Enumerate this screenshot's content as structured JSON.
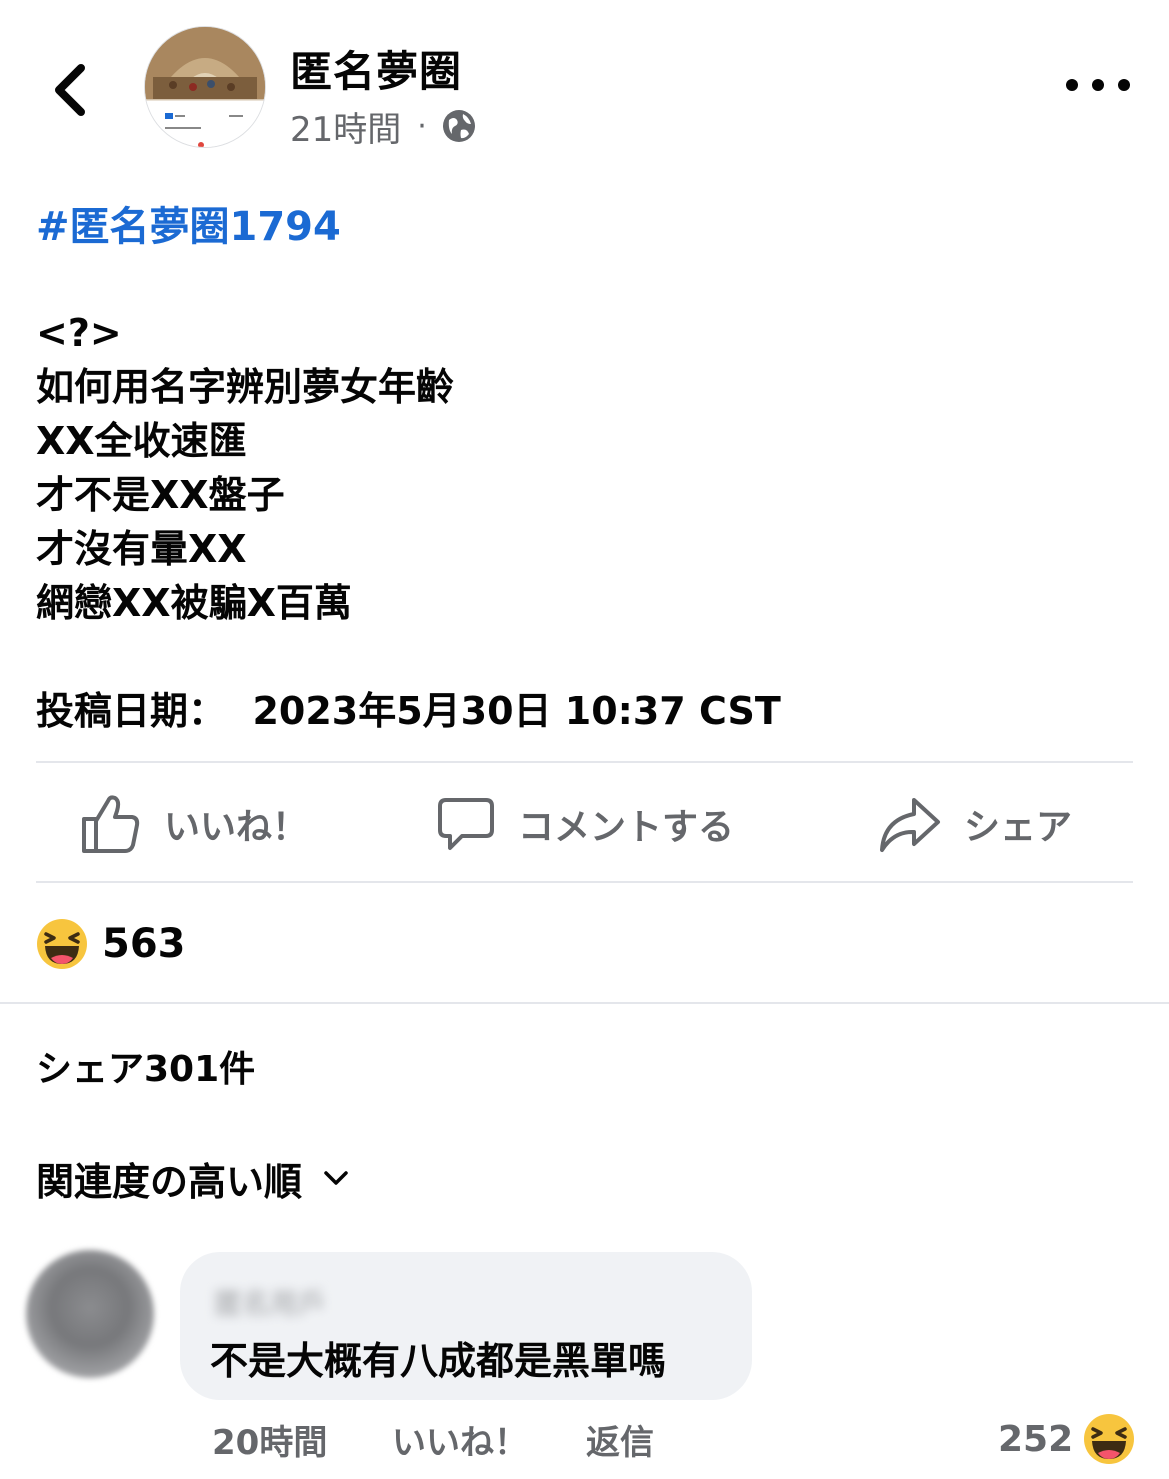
{
  "header": {
    "page_name": "匿名夢圈",
    "time_ago": "21時間",
    "separator": "·",
    "privacy_icon": "globe-icon",
    "back_icon": "chevron-left-icon",
    "more_icon": "more-horizontal-icon"
  },
  "post": {
    "hashtag": "#匿名夢圈1794",
    "lines": [
      "<?>",
      "如何用名字辨別夢女年齡",
      "XX全收速匯",
      "才不是XX盤子",
      "才沒有暈XX",
      "網戀XX被騙X百萬"
    ],
    "date_line": "投稿日期：  2023年5月30日 10:37 CST"
  },
  "actions": {
    "like_label": "いいね！",
    "comment_label": "コメントする",
    "share_label": "シェア",
    "like_icon": "thumbs-up-icon",
    "comment_icon": "speech-bubble-icon",
    "share_icon": "share-arrow-icon"
  },
  "reactions": {
    "icon": "laughing-emoji-icon",
    "count": "563"
  },
  "shares": {
    "text": "シェア301件"
  },
  "comments": {
    "sort_label": "関連度の高い順",
    "sort_icon": "chevron-down-icon",
    "items": [
      {
        "author": "匿名用戶",
        "text": "不是大概有八成都是黑單嗎",
        "time_ago": "20時間",
        "like_label": "いいね！",
        "reply_label": "返信",
        "reaction_count": "252",
        "reaction_icon": "laughing-emoji-icon"
      }
    ]
  },
  "colors": {
    "text": "#050505",
    "secondary_text": "#65676b",
    "hashtag": "#1b6ad3",
    "divider": "#e4e6eb",
    "bubble": "#f0f2f5",
    "emoji_face": "#f7c53e"
  }
}
